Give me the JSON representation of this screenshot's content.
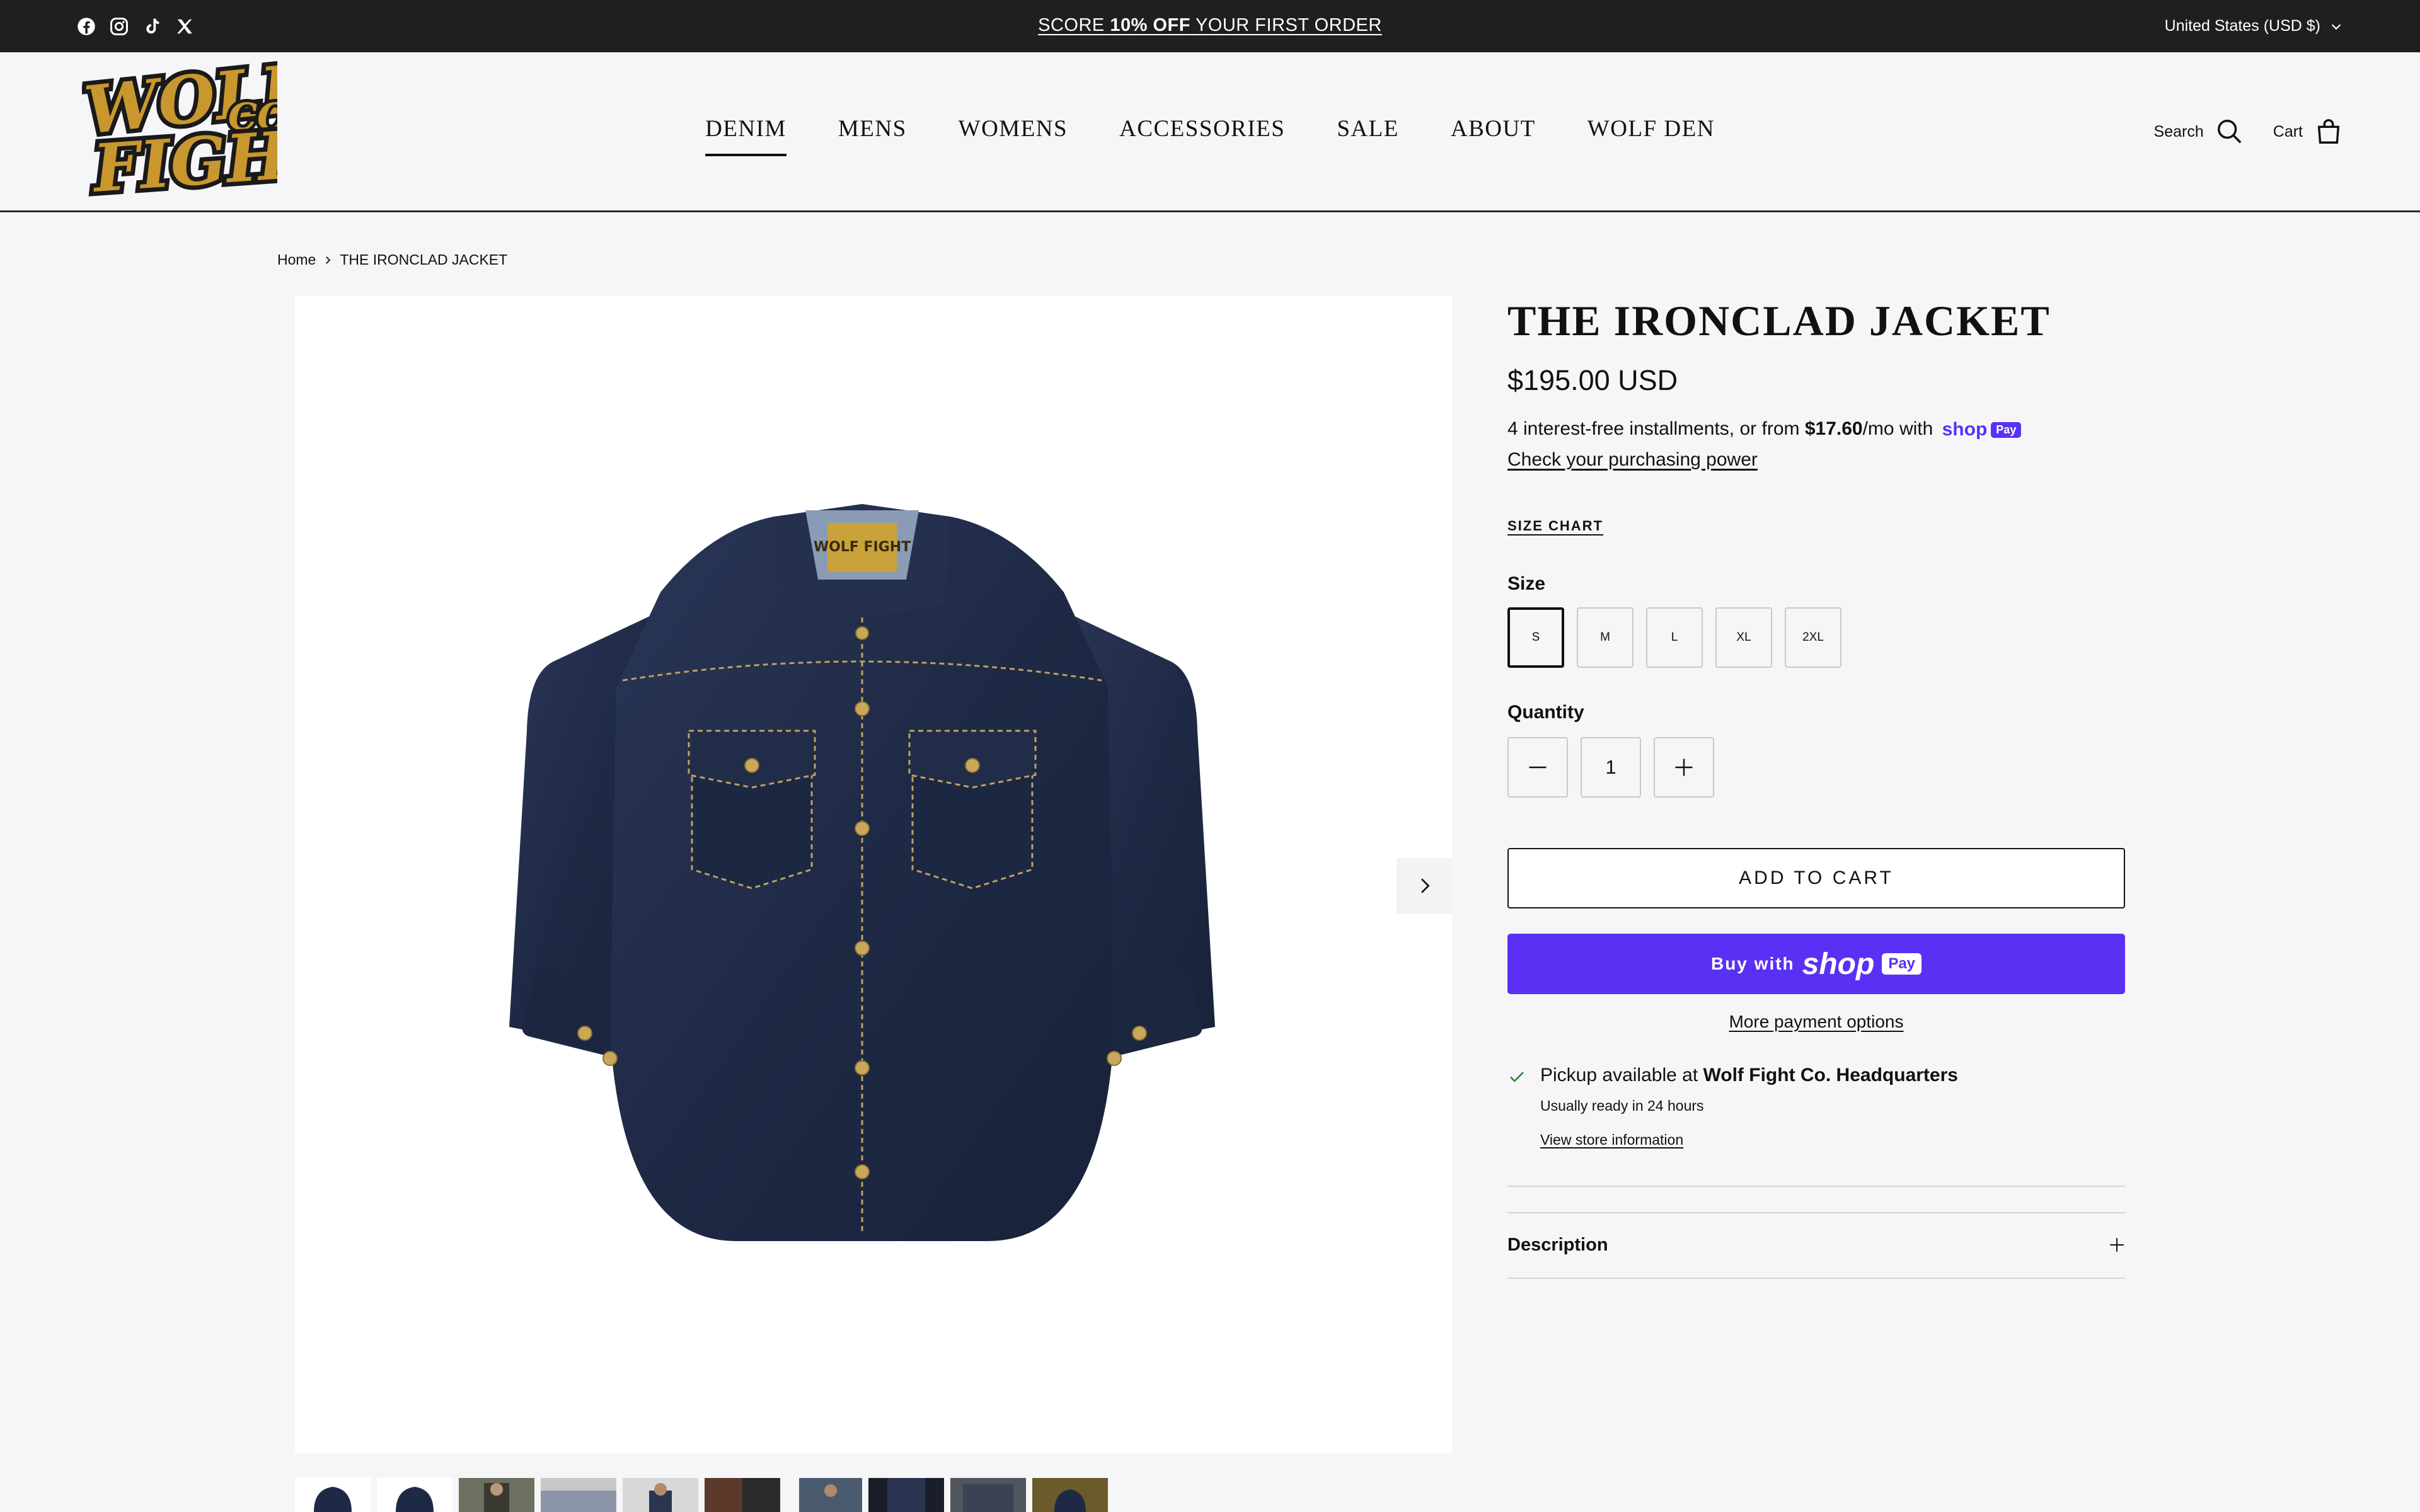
{
  "announcement": {
    "promo_prefix": "SCORE ",
    "promo_bold": "10% OFF",
    "promo_suffix": " YOUR FIRST ORDER",
    "country": "United States (USD $)",
    "social_icons": [
      "facebook-icon",
      "instagram-icon",
      "tiktok-icon",
      "x-icon"
    ]
  },
  "header": {
    "logo_line1": "WOLF",
    "logo_co": "CO",
    "logo_line2": "FIGHT",
    "nav": [
      "DENIM",
      "MENS",
      "WOMENS",
      "ACCESSORIES",
      "SALE",
      "ABOUT",
      "WOLF DEN"
    ],
    "active_nav": "DENIM",
    "search_label": "Search",
    "cart_label": "Cart"
  },
  "breadcrumb": {
    "home": "Home",
    "current": "THE IRONCLAD JACKET"
  },
  "gallery": {
    "thumbnail_count": 10,
    "label_text": "WOLF FIGHT"
  },
  "product": {
    "title": "THE IRONCLAD JACKET",
    "price": "$195.00 USD",
    "installments_prefix": "4 interest-free installments, or from ",
    "installments_amount": "$17.60",
    "installments_suffix": "/mo with ",
    "shop_word": "shop",
    "pay_word": "Pay",
    "check_power": "Check your purchasing power",
    "size_chart": "SIZE CHART",
    "size_label": "Size",
    "sizes": [
      "S",
      "M",
      "L",
      "XL",
      "2XL"
    ],
    "selected_size": "S",
    "quantity_label": "Quantity",
    "quantity": "1",
    "add_to_cart": "ADD TO CART",
    "buy_with": "Buy with",
    "more_payment": "More payment options",
    "pickup_prefix": "Pickup available at ",
    "pickup_location": "Wolf Fight Co. Headquarters",
    "pickup_ready": "Usually ready in 24 hours",
    "store_info": "View store information",
    "description_label": "Description"
  },
  "colors": {
    "announcement_bg": "#1f1f1f",
    "page_bg": "#f6f6f8",
    "shop_pay": "#5a31f4",
    "denim": "#1e2a45",
    "logo_gold": "#c8972e",
    "pickup_check": "#2e7d32"
  }
}
